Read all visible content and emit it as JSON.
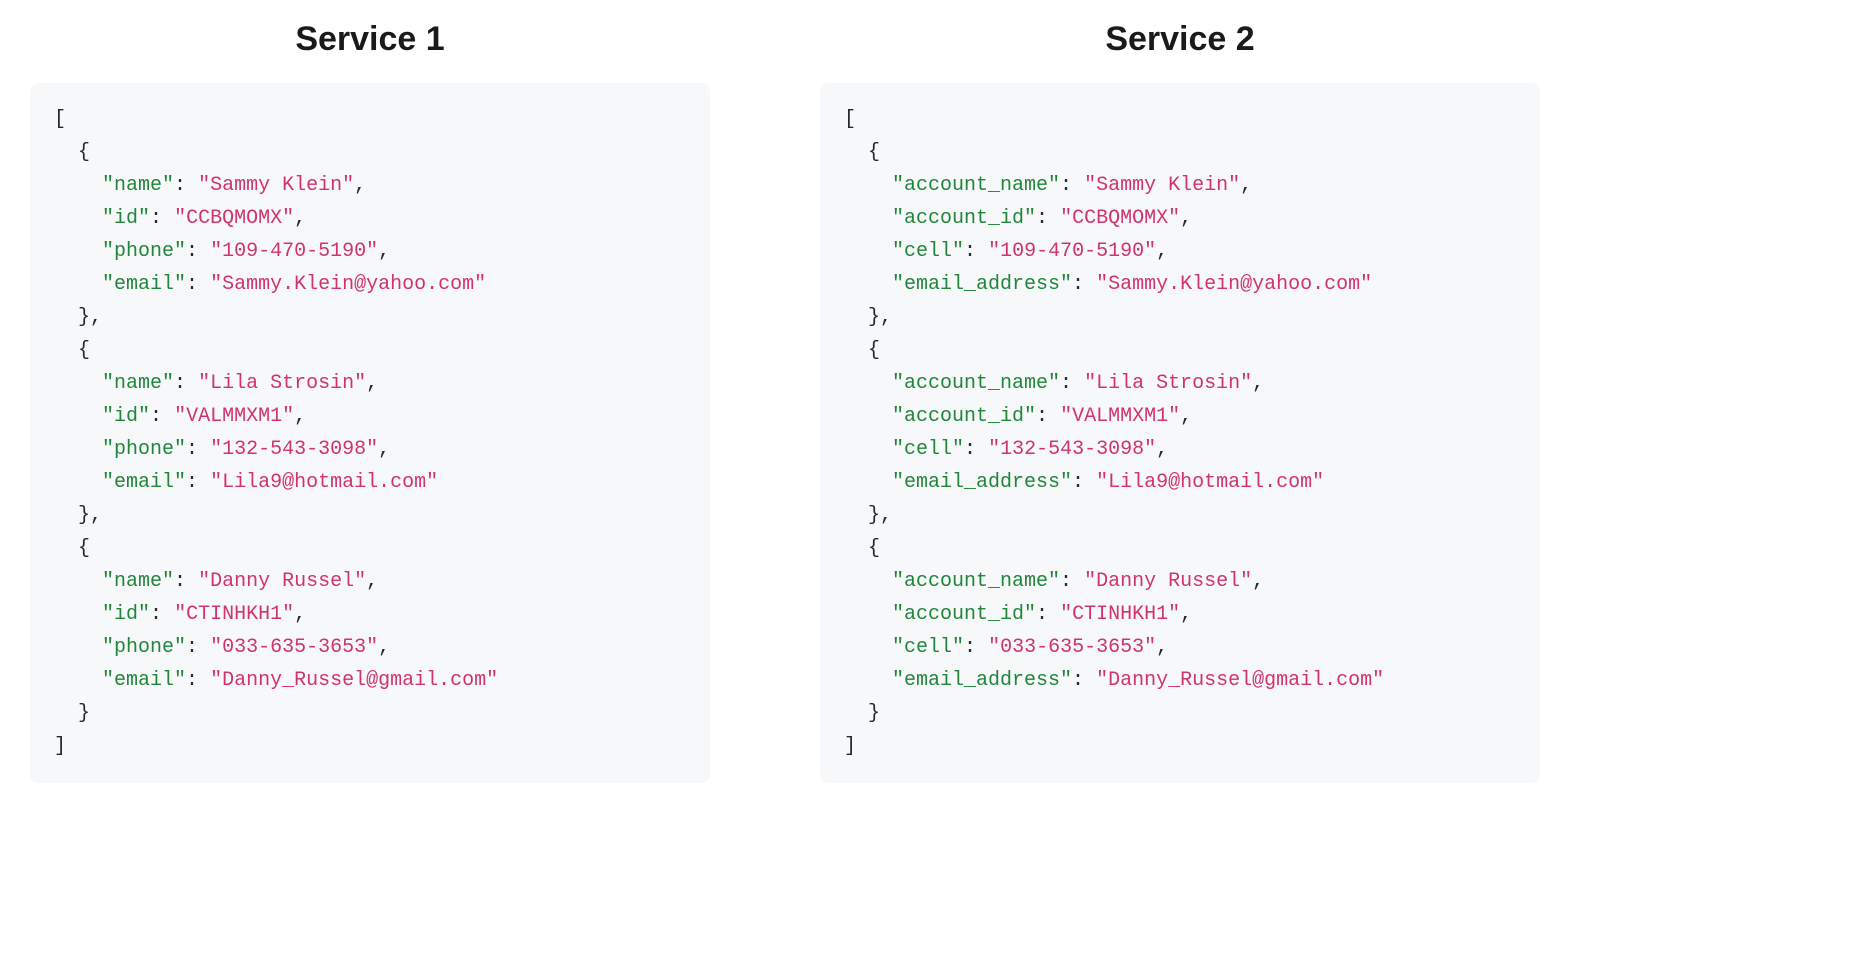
{
  "services": [
    {
      "title": "Service 1",
      "keys": [
        "name",
        "id",
        "phone",
        "email"
      ],
      "records": [
        {
          "values": [
            "Sammy Klein",
            "CCBQMOMX",
            "109-470-5190",
            "Sammy.Klein@yahoo.com"
          ]
        },
        {
          "values": [
            "Lila Strosin",
            "VALMMXM1",
            "132-543-3098",
            "Lila9@hotmail.com"
          ]
        },
        {
          "values": [
            "Danny Russel",
            "CTINHKH1",
            "033-635-3653",
            "Danny_Russel@gmail.com"
          ]
        }
      ]
    },
    {
      "title": "Service 2",
      "keys": [
        "account_name",
        "account_id",
        "cell",
        "email_address"
      ],
      "records": [
        {
          "values": [
            "Sammy Klein",
            "CCBQMOMX",
            "109-470-5190",
            "Sammy.Klein@yahoo.com"
          ]
        },
        {
          "values": [
            "Lila Strosin",
            "VALMMXM1",
            "132-543-3098",
            "Lila9@hotmail.com"
          ]
        },
        {
          "values": [
            "Danny Russel",
            "CTINHKH1",
            "033-635-3653",
            "Danny_Russel@gmail.com"
          ]
        }
      ]
    }
  ]
}
